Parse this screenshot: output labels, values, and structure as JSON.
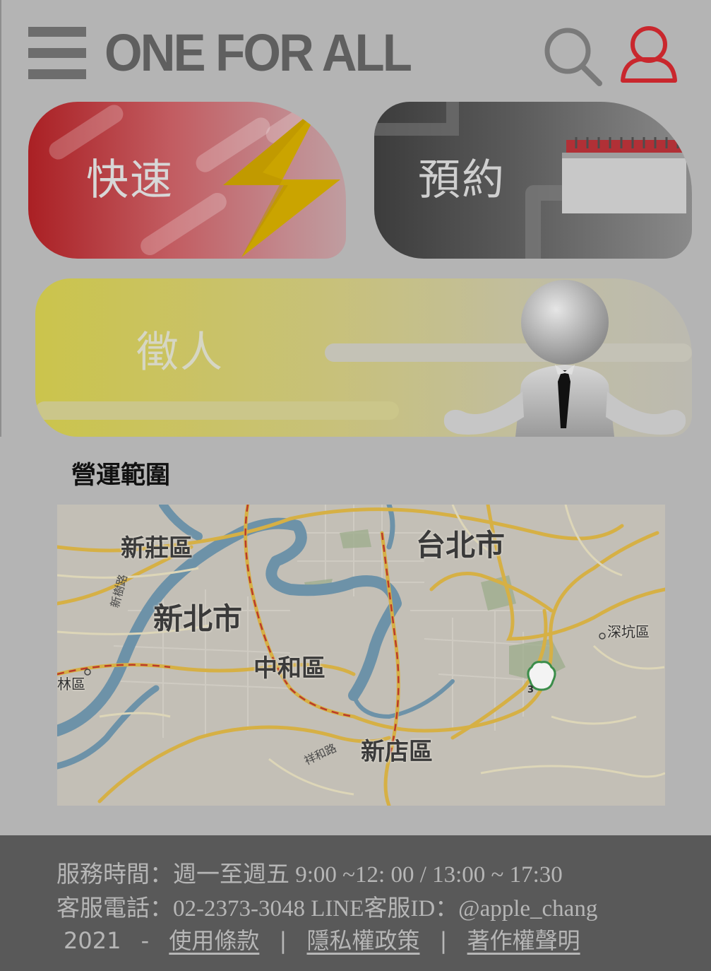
{
  "header": {
    "brand": "ONE FOR ALL",
    "menu_icon": "hamburger-menu-icon",
    "search_icon": "search-icon",
    "user_icon": "user-icon"
  },
  "cards": {
    "fast": {
      "label": "快速",
      "icon": "lightning-bolt-icon",
      "color": "#aa2024"
    },
    "booking": {
      "label": "預約",
      "icon": "calendar-icon",
      "color": "#3c3c3c"
    },
    "recruit": {
      "label": "徵人",
      "icon": "person-figure-icon",
      "color": "#cbc44c"
    }
  },
  "map": {
    "title": "營運範圍",
    "labels": {
      "xinzhuang": "新莊區",
      "taipei": "台北市",
      "newtaipei": "新北市",
      "zhonghe": "中和區",
      "xindian": "新店區",
      "shenkeng": "深坑區",
      "linkou": "林區",
      "xinshu_rd": "新樹路",
      "xianghe_rd": "祥和路",
      "route3": "3"
    }
  },
  "footer": {
    "hours": "服務時間：週一至週五  9:00 ~12: 00  /  13:00 ~ 17:30",
    "contact": "客服電話：02-2373-3048  LINE客服ID：@apple_chang",
    "year": "2021",
    "dash": "-",
    "terms": "使用條款",
    "privacy": "隱私權政策",
    "copyright": "著作權聲明",
    "divider": "|"
  },
  "colors": {
    "background": "#b4b4b4",
    "footer_bg": "#595959",
    "user_icon": "#c9272d"
  }
}
